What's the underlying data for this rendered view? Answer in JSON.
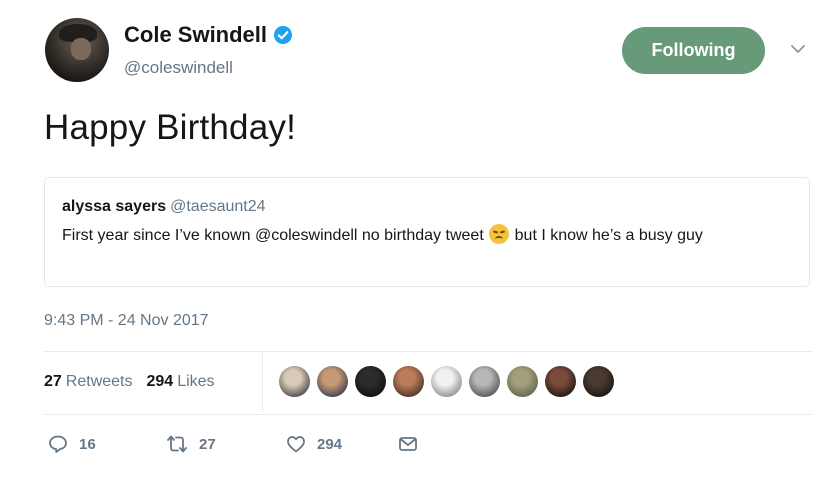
{
  "author": {
    "display_name": "Cole Swindell",
    "handle": "@coleswindell",
    "verified": true
  },
  "follow_button_label": "Following",
  "tweet_text": "Happy Birthday!",
  "quoted_tweet": {
    "display_name": "alyssa sayers",
    "handle": "@taesaunt24",
    "text_before_emoji": "First year since I’ve known @coleswindell no birthday tweet ",
    "emoji_icon": "disappointed-face-icon",
    "text_after_emoji": " but I know he’s a busy guy"
  },
  "timestamp": "9:43 PM - 24 Nov 2017",
  "stats": {
    "retweets_count": "27",
    "retweets_label": "Retweets",
    "likes_count": "294",
    "likes_label": "Likes"
  },
  "liker_avatars": [
    {
      "icon": "liker-avatar-1",
      "colors": [
        "#d9cbb6",
        "#3a3a44"
      ]
    },
    {
      "icon": "liker-avatar-2",
      "colors": [
        "#c89a73",
        "#2b3550"
      ]
    },
    {
      "icon": "liker-avatar-3",
      "colors": [
        "#2c2c2c",
        "#0c0c0c"
      ]
    },
    {
      "icon": "liker-avatar-4",
      "colors": [
        "#bb7c5a",
        "#402a24"
      ]
    },
    {
      "icon": "liker-avatar-5",
      "colors": [
        "#f2f0f0",
        "#858585"
      ]
    },
    {
      "icon": "liker-avatar-6",
      "colors": [
        "#b7b7b7",
        "#4b4b4b"
      ]
    },
    {
      "icon": "liker-avatar-7",
      "colors": [
        "#a39e7c",
        "#5c6048"
      ]
    },
    {
      "icon": "liker-avatar-8",
      "colors": [
        "#7a4a3a",
        "#181212"
      ]
    },
    {
      "icon": "liker-avatar-9",
      "colors": [
        "#4a3a30",
        "#151210"
      ]
    }
  ],
  "actions": {
    "reply_count": "16",
    "retweet_count": "27",
    "like_count": "294"
  },
  "colors": {
    "follow_button": "#669a78",
    "verified_badge": "#1da1f2",
    "secondary_text": "#657786"
  }
}
